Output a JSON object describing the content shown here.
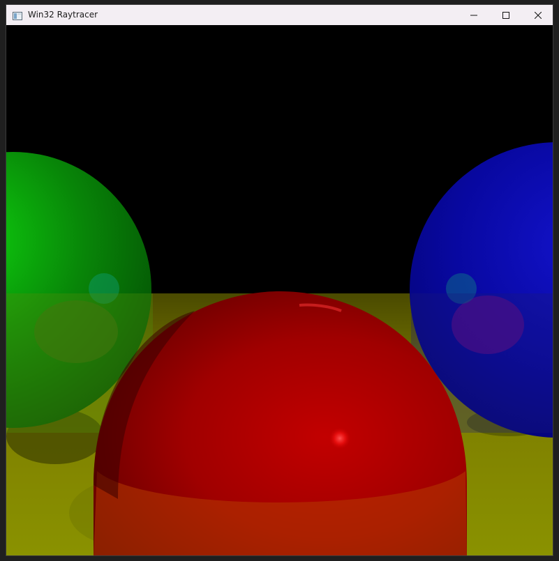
{
  "window": {
    "title": "Win32 Raytracer",
    "app_icon": "window-app-icon",
    "controls": {
      "minimize_icon": "minimize-icon",
      "maximize_icon": "maximize-icon",
      "close_icon": "close-icon"
    }
  },
  "scene": {
    "background_color": "#000000",
    "floor_color": "#8f8f00",
    "spheres": [
      {
        "name": "green-sphere",
        "color": "#0b8f0b"
      },
      {
        "name": "red-sphere",
        "color": "#b00000"
      },
      {
        "name": "blue-sphere",
        "color": "#0000a0"
      }
    ]
  }
}
